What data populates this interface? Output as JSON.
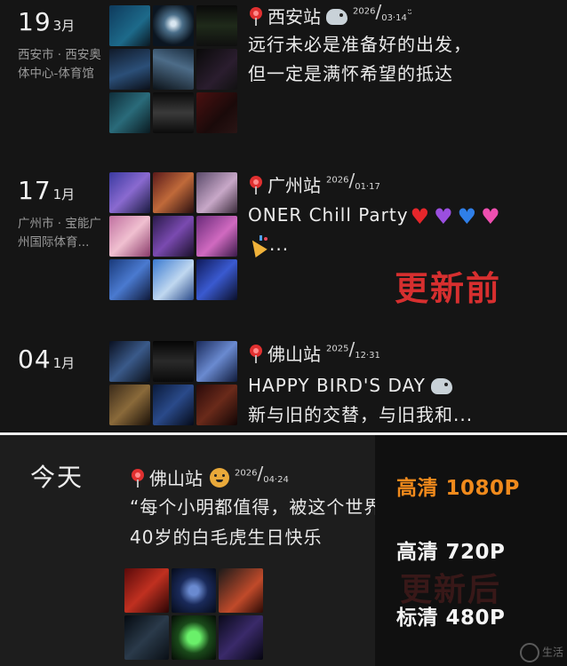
{
  "entries": [
    {
      "day": "19",
      "month": "3月",
      "location": "西安市 · 西安奥体中心-体育馆",
      "station": "西安站",
      "date_year": "2026",
      "date_md": "03·14",
      "lines": [
        "远行未必是准备好的出发，",
        "但一定是满怀希望的抵达"
      ]
    },
    {
      "day": "17",
      "month": "1月",
      "location": "广州市 · 宝能广州国际体育...",
      "station": "广州站",
      "date_year": "2026",
      "date_md": "01·17",
      "lines": [
        "ONER Chill Party",
        "..."
      ]
    },
    {
      "day": "04",
      "month": "1月",
      "location": "",
      "station": "佛山站",
      "date_year": "2025",
      "date_md": "12·31",
      "lines": [
        "HAPPY BIRD'S DAY",
        "新与旧的交替，与旧我和..."
      ]
    }
  ],
  "overlay_before": "更新前",
  "today": {
    "label": "今天",
    "station": "佛山站",
    "date_year": "2026",
    "date_md": "04·24",
    "lines": [
      "“每个小明都值得，被这个世界爱着”",
      "40岁的白毛虎生日快乐"
    ]
  },
  "quality_menu": {
    "options": [
      {
        "label": "高清 1080P",
        "selected": true
      },
      {
        "label": "高清 720P",
        "selected": false
      },
      {
        "label": "标清 480P",
        "selected": false
      }
    ],
    "selected_color": "#f08a1c"
  },
  "overlay_after": "更新后",
  "icons": [
    "pin-icon",
    "bird-emoji-icon",
    "smile-icon",
    "heart-red-icon",
    "heart-purple-icon",
    "heart-blue-icon",
    "heart-pink-icon",
    "party-popper-icon",
    "tiger-emoji-icon"
  ],
  "watermark": "生活"
}
